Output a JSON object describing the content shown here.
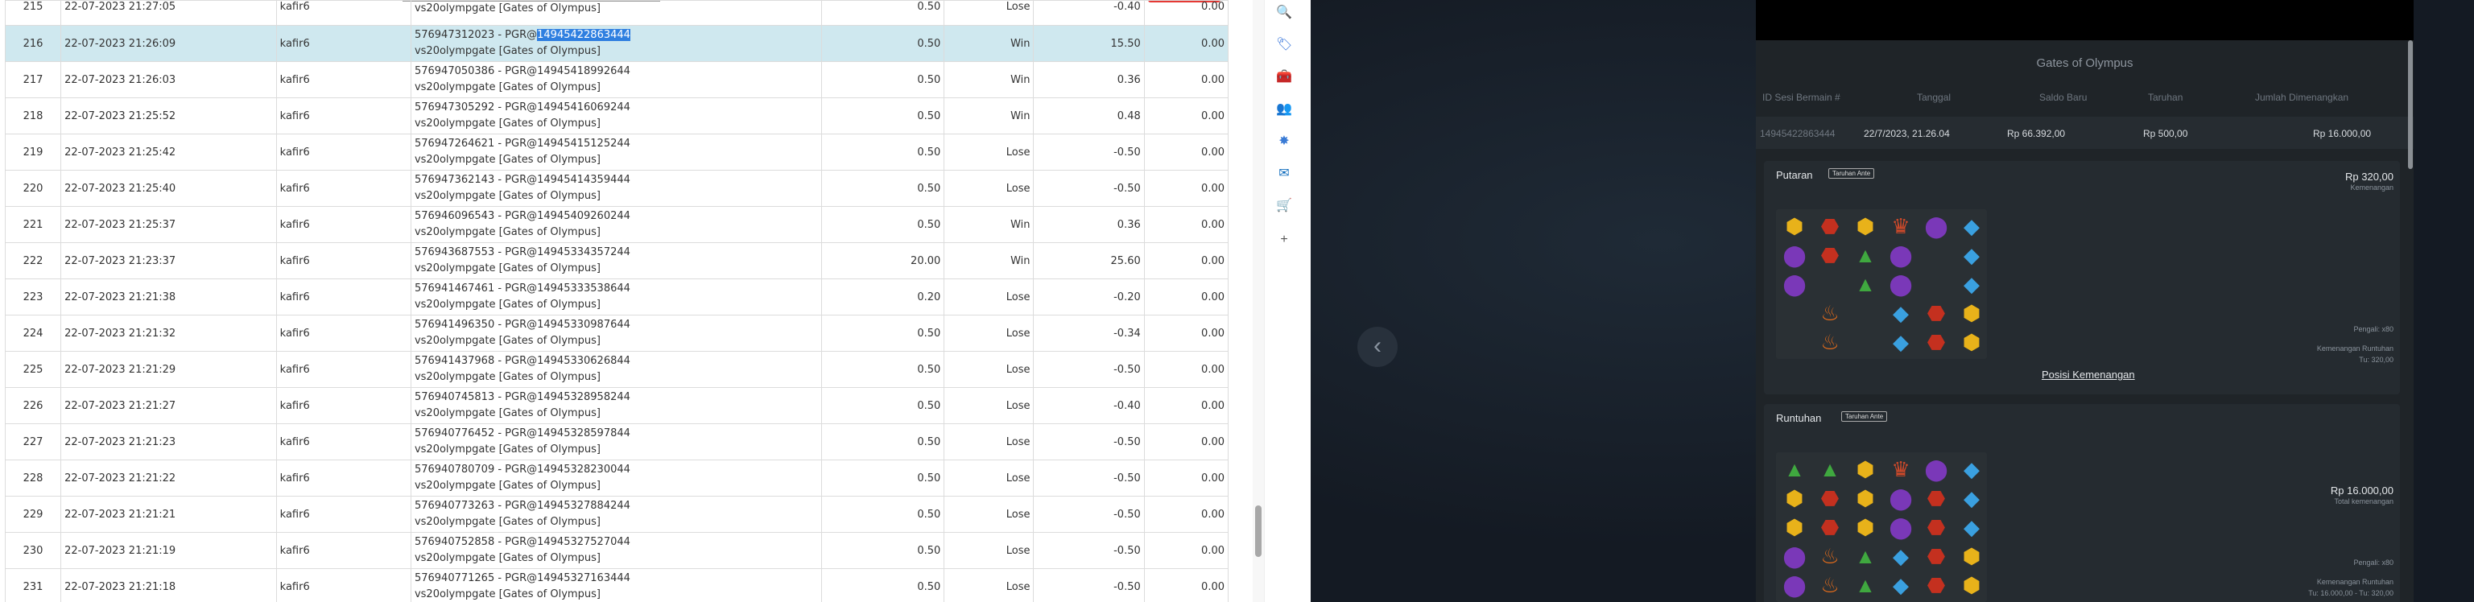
{
  "transactions": [
    {
      "no": "215",
      "date": "22-07-2023 21:27:05",
      "user": "kafir6",
      "desc1": "",
      "desc2": "vs20olympgate [Gates of Olympus]",
      "bet": "0.50",
      "result": "Lose",
      "win": "-0.40",
      "balance": "0.00",
      "first": true
    },
    {
      "no": "216",
      "date": "22-07-2023 21:26:09",
      "user": "kafir6",
      "desc1": "576947312023 - PGR@",
      "hl": "14945422863444",
      "desc2": "vs20olympgate [Gates of Olympus]",
      "bet": "0.50",
      "result": "Win",
      "win": "15.50",
      "balance": "0.00",
      "sel": true
    },
    {
      "no": "217",
      "date": "22-07-2023 21:26:03",
      "user": "kafir6",
      "desc1": "576947050386 - PGR@14945418992644",
      "desc2": "vs20olympgate [Gates of Olympus]",
      "bet": "0.50",
      "result": "Win",
      "win": "0.36",
      "balance": "0.00"
    },
    {
      "no": "218",
      "date": "22-07-2023 21:25:52",
      "user": "kafir6",
      "desc1": "576947305292 - PGR@14945416069244",
      "desc2": "vs20olympgate [Gates of Olympus]",
      "bet": "0.50",
      "result": "Win",
      "win": "0.48",
      "balance": "0.00"
    },
    {
      "no": "219",
      "date": "22-07-2023 21:25:42",
      "user": "kafir6",
      "desc1": "576947264621 - PGR@14945415125244",
      "desc2": "vs20olympgate [Gates of Olympus]",
      "bet": "0.50",
      "result": "Lose",
      "win": "-0.50",
      "balance": "0.00"
    },
    {
      "no": "220",
      "date": "22-07-2023 21:25:40",
      "user": "kafir6",
      "desc1": "576947362143 - PGR@14945414359444",
      "desc2": "vs20olympgate [Gates of Olympus]",
      "bet": "0.50",
      "result": "Lose",
      "win": "-0.50",
      "balance": "0.00"
    },
    {
      "no": "221",
      "date": "22-07-2023 21:25:37",
      "user": "kafir6",
      "desc1": "576946096543 - PGR@14945409260244",
      "desc2": "vs20olympgate [Gates of Olympus]",
      "bet": "0.50",
      "result": "Win",
      "win": "0.36",
      "balance": "0.00"
    },
    {
      "no": "222",
      "date": "22-07-2023 21:23:37",
      "user": "kafir6",
      "desc1": "576943687553 - PGR@14945334357244",
      "desc2": "vs20olympgate [Gates of Olympus]",
      "bet": "20.00",
      "result": "Win",
      "win": "25.60",
      "balance": "0.00"
    },
    {
      "no": "223",
      "date": "22-07-2023 21:21:38",
      "user": "kafir6",
      "desc1": "576941467461 - PGR@14945333538644",
      "desc2": "vs20olympgate [Gates of Olympus]",
      "bet": "0.20",
      "result": "Lose",
      "win": "-0.20",
      "balance": "0.00"
    },
    {
      "no": "224",
      "date": "22-07-2023 21:21:32",
      "user": "kafir6",
      "desc1": "576941496350 - PGR@14945330987644",
      "desc2": "vs20olympgate [Gates of Olympus]",
      "bet": "0.50",
      "result": "Lose",
      "win": "-0.34",
      "balance": "0.00"
    },
    {
      "no": "225",
      "date": "22-07-2023 21:21:29",
      "user": "kafir6",
      "desc1": "576941437968 - PGR@14945330626844",
      "desc2": "vs20olympgate [Gates of Olympus]",
      "bet": "0.50",
      "result": "Lose",
      "win": "-0.50",
      "balance": "0.00"
    },
    {
      "no": "226",
      "date": "22-07-2023 21:21:27",
      "user": "kafir6",
      "desc1": "576940745813 - PGR@14945328958244",
      "desc2": "vs20olympgate [Gates of Olympus]",
      "bet": "0.50",
      "result": "Lose",
      "win": "-0.40",
      "balance": "0.00"
    },
    {
      "no": "227",
      "date": "22-07-2023 21:21:23",
      "user": "kafir6",
      "desc1": "576940776452 - PGR@14945328597844",
      "desc2": "vs20olympgate [Gates of Olympus]",
      "bet": "0.50",
      "result": "Lose",
      "win": "-0.50",
      "balance": "0.00"
    },
    {
      "no": "228",
      "date": "22-07-2023 21:21:22",
      "user": "kafir6",
      "desc1": "576940780709 - PGR@14945328230044",
      "desc2": "vs20olympgate [Gates of Olympus]",
      "bet": "0.50",
      "result": "Lose",
      "win": "-0.50",
      "balance": "0.00"
    },
    {
      "no": "229",
      "date": "22-07-2023 21:21:21",
      "user": "kafir6",
      "desc1": "576940773263 - PGR@14945327884244",
      "desc2": "vs20olympgate [Gates of Olympus]",
      "bet": "0.50",
      "result": "Lose",
      "win": "-0.50",
      "balance": "0.00"
    },
    {
      "no": "230",
      "date": "22-07-2023 21:21:19",
      "user": "kafir6",
      "desc1": "576940752858 - PGR@14945327527044",
      "desc2": "vs20olympgate [Gates of Olympus]",
      "bet": "0.50",
      "result": "Lose",
      "win": "-0.50",
      "balance": "0.00"
    },
    {
      "no": "231",
      "date": "22-07-2023 21:21:18",
      "user": "kafir6",
      "desc1": "576940771265 - PGR@14945327163444",
      "desc2": "vs20olympgate [Gates of Olympus]",
      "bet": "0.50",
      "result": "Lose",
      "win": "-0.50",
      "balance": "0.00"
    }
  ],
  "edge_sidebar": {
    "icons": [
      "search-icon",
      "tag-icon",
      "toolbox-icon",
      "people-icon",
      "copilot-icon",
      "outlook-icon",
      "shopping-icon",
      "add-icon"
    ],
    "glyphs": [
      "🔍",
      "🏷",
      "🧰",
      "👥",
      "✸",
      "✉",
      "🛒",
      "+"
    ],
    "colors": [
      "#4a6fb5",
      "#2f6fd8",
      "#d9531e",
      "#7b3fb3",
      "#3a7bd5",
      "#0f6cbd",
      "#3a8fd0",
      "#555"
    ]
  },
  "detail": {
    "title": "Gates of Olympus",
    "headers": [
      "ID Sesi Bermain #",
      "Tanggal",
      "Saldo Baru",
      "Taruhan",
      "Jumlah Dimenangkan"
    ],
    "values": [
      "14945422863444",
      "22/7/2023, 21.26.04",
      "Rp 66.392,00",
      "Rp 500,00",
      "Rp 16.000,00"
    ],
    "putaran": {
      "label": "Putaran",
      "tag": "Taruhan Ante",
      "amount": "Rp 320,00",
      "amount_sub": "Kemenangan",
      "pengali": "Pengali: x80",
      "note1": "Kemenangan Runtuhan",
      "note2": "Tu: 320,00"
    },
    "posisi": "Posisi Kemenangan",
    "runtuhan": {
      "label": "Runtuhan",
      "tag": "Taruhan Ante",
      "amount": "Rp 16.000,00",
      "amount_sub": "Total kemenangan",
      "pengali": "Pengali: x80",
      "note1": "Kemenangan Runtuhan",
      "note2": "Tu: 16.000,00 - Tu: 320,00"
    },
    "grid1": [
      [
        "hex",
        "ruby",
        "hex",
        "crown",
        "purple",
        "blue"
      ],
      [
        "purple",
        "ruby",
        "green",
        "purple",
        "",
        "blue"
      ],
      [
        "purple",
        "",
        "green",
        "purple",
        "",
        "blue"
      ],
      [
        "",
        "chalice",
        "",
        "blue",
        "ruby",
        "hex"
      ],
      [
        "",
        "chalice",
        "",
        "blue",
        "ruby",
        "hex"
      ]
    ],
    "grid2": [
      [
        "green",
        "green",
        "hex",
        "crown",
        "purple",
        "blue"
      ],
      [
        "hex",
        "ruby",
        "hex",
        "purple",
        "ruby",
        "blue"
      ],
      [
        "hex",
        "ruby",
        "hex",
        "purple",
        "ruby",
        "blue"
      ],
      [
        "purple",
        "chalice",
        "green",
        "blue",
        "ruby",
        "hex"
      ],
      [
        "purple",
        "chalice",
        "green",
        "blue",
        "ruby",
        "hex"
      ]
    ]
  },
  "symbol_style": {
    "hex": {
      "glyph": "⬢",
      "color": "#e8b21a"
    },
    "ruby": {
      "glyph": "⬣",
      "color": "#c4301f"
    },
    "crown": {
      "glyph": "♛",
      "color": "#d24a2a"
    },
    "purple": {
      "glyph": "⬤",
      "color": "#7a38b8"
    },
    "blue": {
      "glyph": "◆",
      "color": "#3aa0e0"
    },
    "green": {
      "glyph": "▲",
      "color": "#3fa83f"
    },
    "chalice": {
      "glyph": "♨",
      "color": "#e06b1c"
    }
  }
}
